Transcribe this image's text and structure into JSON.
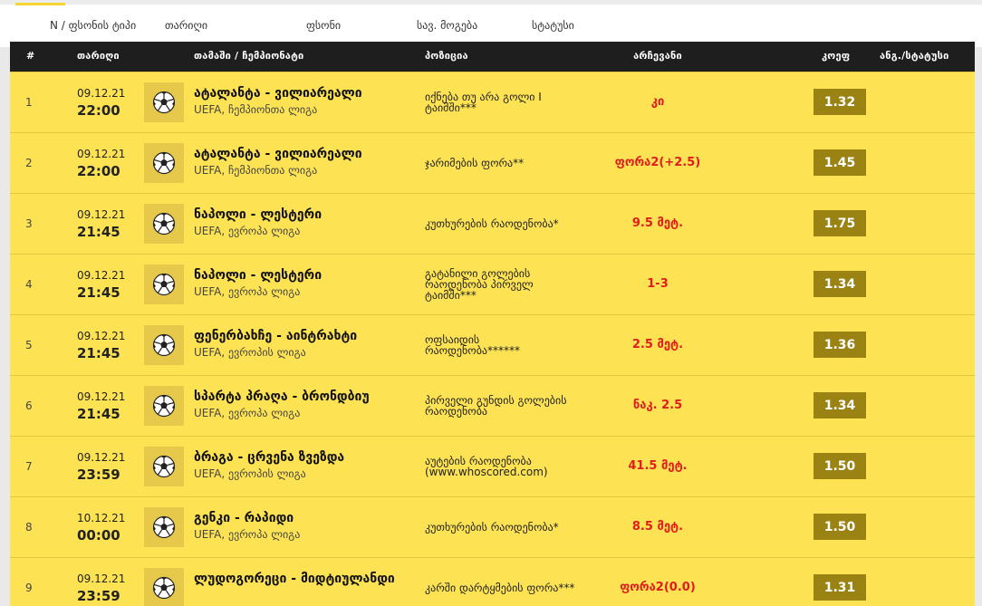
{
  "filter_tabs": [
    {
      "label": "N / ფსონის ტიპი"
    },
    {
      "label": "თარიღი"
    },
    {
      "label": "ფსონი"
    },
    {
      "label": "სავ. მოგება"
    },
    {
      "label": "სტატუსი"
    }
  ],
  "table": {
    "headers": {
      "num": "#",
      "date": "თარიღი",
      "match": "თამაში / ჩემპიონატი",
      "position": "პოზიცია",
      "choice": "არჩევანი",
      "coef": "კოეფ",
      "status": "ანგ./სტატუსი"
    },
    "rows": [
      {
        "num": "1",
        "date": "09.12.21",
        "time": "22:00",
        "match": "ატალანტა - ვილიარეალი",
        "league": "UEFA, ჩემპიონთა ლიგა",
        "position": [
          "იქნება თუ არა გოლი I",
          "ტაიმში***"
        ],
        "choice": "კი",
        "coef": "1.32"
      },
      {
        "num": "2",
        "date": "09.12.21",
        "time": "22:00",
        "match": "ატალანტა - ვილიარეალი",
        "league": "UEFA, ჩემპიონთა ლიგა",
        "position": [
          "ჯარიმების ფორა**"
        ],
        "choice": "ფორა2(+2.5)",
        "coef": "1.45"
      },
      {
        "num": "3",
        "date": "09.12.21",
        "time": "21:45",
        "match": "ნაპოლი - ლესტერი",
        "league": "UEFA, ევროპა ლიგა",
        "position": [
          "კუთხურების რაოდენობა*"
        ],
        "choice": "9.5 მეტ.",
        "coef": "1.75"
      },
      {
        "num": "4",
        "date": "09.12.21",
        "time": "21:45",
        "match": "ნაპოლი - ლესტერი",
        "league": "UEFA, ევროპა ლიგა",
        "position": [
          "გატანილი გოლების",
          "რაოდენობა პირველ",
          "ტაიმში***"
        ],
        "choice": "1-3",
        "coef": "1.34"
      },
      {
        "num": "5",
        "date": "09.12.21",
        "time": "21:45",
        "match": "ფენერბახჩე - აინტრახტი",
        "league": "UEFA, ევროპის ლიგა",
        "position": [
          "ოფსაიდის",
          "რაოდენობა******"
        ],
        "choice": "2.5 მეტ.",
        "coef": "1.36"
      },
      {
        "num": "6",
        "date": "09.12.21",
        "time": "21:45",
        "match": "სპარტა პრაღა - ბრონდბიუ",
        "league": "UEFA, ევროპა ლიგა",
        "position": [
          "პირველი გუნდის გოლების",
          "რაოდენობა"
        ],
        "choice": "ნაკ. 2.5",
        "coef": "1.34"
      },
      {
        "num": "7",
        "date": "09.12.21",
        "time": "23:59",
        "match": "ბრაგა - ცრვენა ზვეზდა",
        "league": "UEFA, ევროპის ლიგა",
        "position": [
          "აუტების რაოდენობა",
          "(www.whoscored.com)"
        ],
        "choice": "41.5 მეტ.",
        "coef": "1.50"
      },
      {
        "num": "8",
        "date": "10.12.21",
        "time": "00:00",
        "match": "გენკი - რაპიდი",
        "league": "UEFA, ევროპა ლიგა",
        "position": [
          "კუთხურების რაოდენობა*"
        ],
        "choice": "8.5 მეტ.",
        "coef": "1.50"
      },
      {
        "num": "9",
        "date": "09.12.21",
        "time": "23:59",
        "match": "ლუდოგორეცი - მიდტიულანდი",
        "league": "",
        "position": [
          "კარში დარტყმების ფორა***"
        ],
        "choice": "ფორა2(0.0)",
        "coef": "1.31"
      }
    ]
  }
}
